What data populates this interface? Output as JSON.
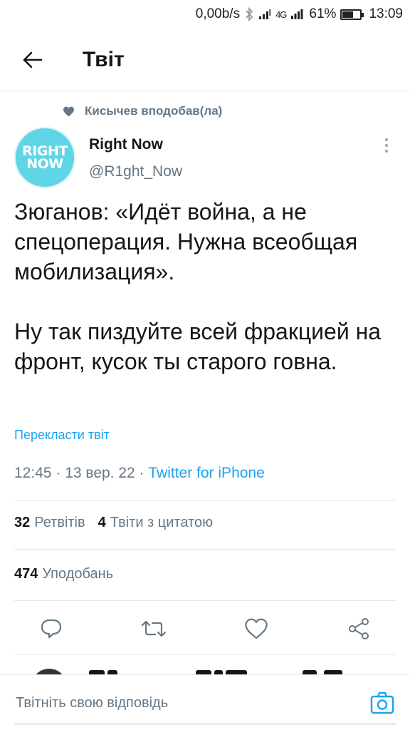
{
  "status_bar": {
    "net_speed": "0,00b/s",
    "signal_label": "4G",
    "battery_percent": "61%",
    "battery_level": 0.61,
    "time": "13:09"
  },
  "header": {
    "title": "Твіт",
    "back_icon": "arrow-left-icon"
  },
  "social_context": {
    "icon": "heart-filled-icon",
    "text": "Кисычев вподобав(ла)"
  },
  "author": {
    "avatar_line1": "RIGHT",
    "avatar_line2": "NOW",
    "avatar_color": "#5fd5e6",
    "name": "Right Now",
    "handle": "@R1ght_Now"
  },
  "tweet": {
    "text": "Зюганов: «Идёт война, а не спецоперация. Нужна всеобщая мобилизация».\n\nНу так пиздуйте всей фракцией на фронт, кусок ты старого говна.",
    "translate_label": "Перекласти твіт",
    "timestamp": "12:45 · 13 вер. 22 · ",
    "source": "Twitter for iPhone"
  },
  "stats": {
    "retweets_count": "32",
    "retweets_label": "Ретвітів",
    "quotes_count": "4",
    "quotes_label": "Твіти з цитатою",
    "likes_count": "474",
    "likes_label": "Уподобань"
  },
  "actions": [
    "reply-icon",
    "retweet-icon",
    "like-icon",
    "share-icon"
  ],
  "reply_bar": {
    "placeholder": "Твітніть свою відповідь",
    "camera_icon": "camera-icon"
  },
  "colors": {
    "accent": "#1da1f2",
    "secondary_text": "#657786",
    "divider": "#e1e8ed"
  }
}
